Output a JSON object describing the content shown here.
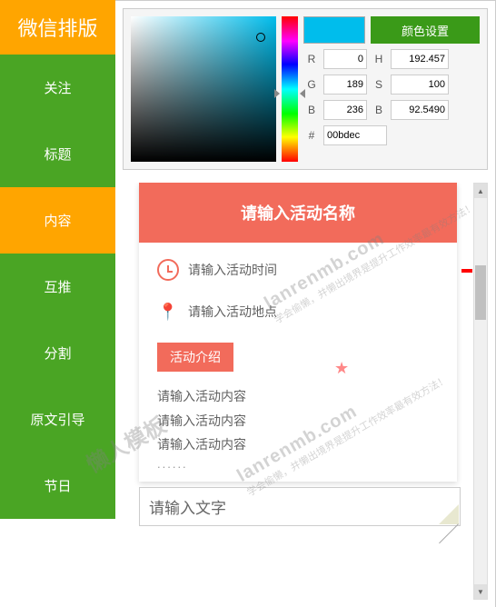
{
  "sidebar": {
    "header": "微信排版",
    "items": [
      {
        "label": "关注"
      },
      {
        "label": "标题"
      },
      {
        "label": "内容"
      },
      {
        "label": "互推"
      },
      {
        "label": "分割"
      },
      {
        "label": "原文引导"
      },
      {
        "label": "节日"
      }
    ]
  },
  "colorpicker": {
    "button": "颜色设置",
    "preview_color": "#00bdec",
    "R": "0",
    "G": "189",
    "B": "236",
    "H": "192.457",
    "S": "100",
    "Br": "92.5490",
    "hex": "00bdec"
  },
  "card": {
    "title": "请输入活动名称",
    "time_placeholder": "请输入活动时间",
    "place_placeholder": "请输入活动地点",
    "intro_tag": "活动介绍",
    "content_line": "请输入活动内容",
    "dots": "......"
  },
  "bottom_input": {
    "placeholder": "请输入文字"
  },
  "watermark": {
    "domain": "lanrenmb.com",
    "sub": "学会偷懒，并懒出境界是提升工作效率最有效方法！",
    "brand": "懒人模板"
  }
}
